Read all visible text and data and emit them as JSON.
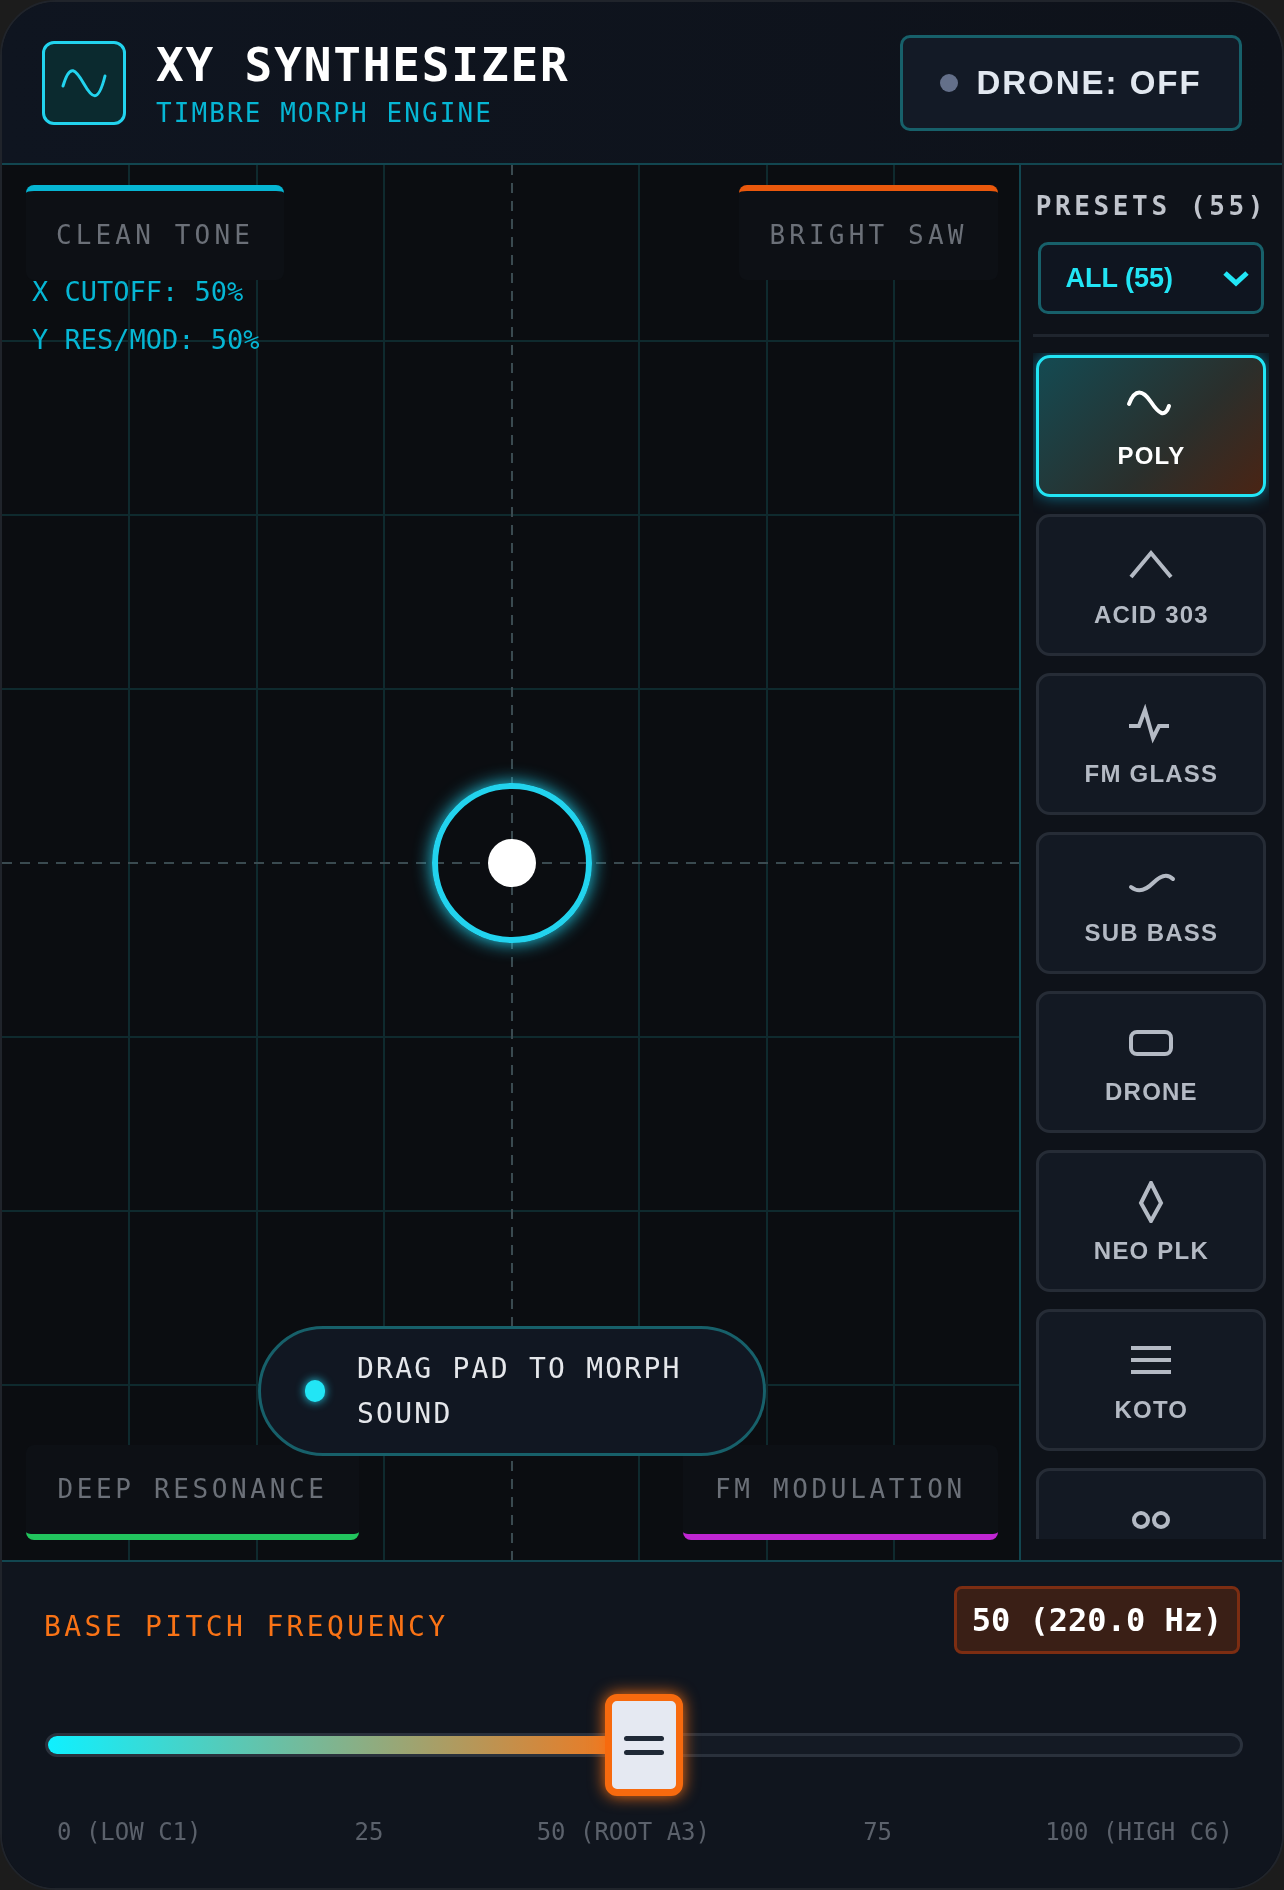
{
  "header": {
    "title": "XY SYNTHESIZER",
    "subtitle": "TIMBRE MORPH ENGINE",
    "drone_button": {
      "label": "DRONE: OFF",
      "on": false
    }
  },
  "pad": {
    "corners": [
      {
        "label": "CLEAN TONE",
        "color": "#06b6d4"
      },
      {
        "label": "BRIGHT SAW",
        "color": "#ea580c"
      },
      {
        "label": "DEEP RESONANCE",
        "color": "#22c55e"
      },
      {
        "label": "FM MODULATION",
        "color": "#c026d3"
      }
    ],
    "readouts": [
      "X CUTOFF: 50%",
      "Y RES/MOD: 50%"
    ],
    "hint": "DRAG PAD TO MORPH SOUND"
  },
  "presets": {
    "title": "PRESETS (55)",
    "filter": "ALL (55)",
    "items": [
      {
        "label": "POLY",
        "kind": "sine",
        "selected": true
      },
      {
        "label": "ACID 303",
        "kind": "triangle",
        "selected": false
      },
      {
        "label": "FM GLASS",
        "kind": "pulse",
        "selected": false
      },
      {
        "label": "SUB BASS",
        "kind": "wave",
        "selected": false
      },
      {
        "label": "DRONE",
        "kind": "rectangle",
        "selected": false
      },
      {
        "label": "NEO PLK",
        "kind": "diamond",
        "selected": false
      },
      {
        "label": "KOTO",
        "kind": "lines",
        "selected": false
      },
      {
        "kind": "circles",
        "selected": false
      }
    ]
  },
  "pitch": {
    "label": "BASE PITCH FREQUENCY",
    "value": "50 (220.0 Hz)",
    "level": 0.5,
    "ticks": [
      "0 (LOW C1)",
      "25",
      "50 (ROOT A3)",
      "75",
      "100 (HIGH C6)"
    ]
  }
}
